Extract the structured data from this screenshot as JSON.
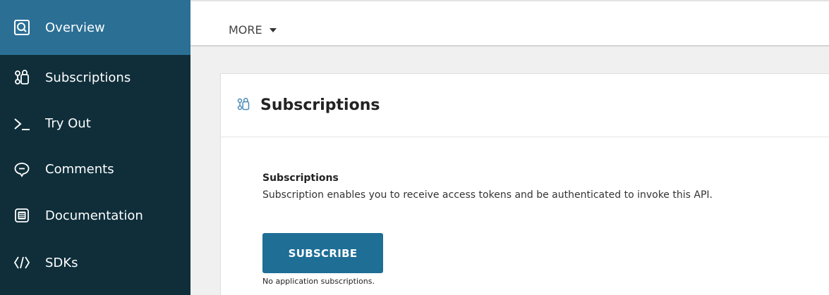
{
  "sidebar": {
    "items": [
      {
        "label": "Overview",
        "icon": "overview-icon",
        "active": true
      },
      {
        "label": "Subscriptions",
        "icon": "subscriptions-icon"
      },
      {
        "label": "Try Out",
        "icon": "terminal-icon"
      },
      {
        "label": "Comments",
        "icon": "comment-icon"
      },
      {
        "label": "Documentation",
        "icon": "document-icon"
      },
      {
        "label": "SDKs",
        "icon": "code-icon"
      }
    ]
  },
  "topbar": {
    "more_label": "MORE"
  },
  "card": {
    "title": "Subscriptions",
    "section_title": "Subscriptions",
    "description": "Subscription enables you to receive access tokens and be authenticated to invoke this API.",
    "subscribe_label": "SUBSCRIBE",
    "status_text": "No application subscriptions."
  },
  "colors": {
    "sidebar_bg": "#0f2e3a",
    "sidebar_active": "#2b6f95",
    "accent_button": "#1e6e96"
  }
}
